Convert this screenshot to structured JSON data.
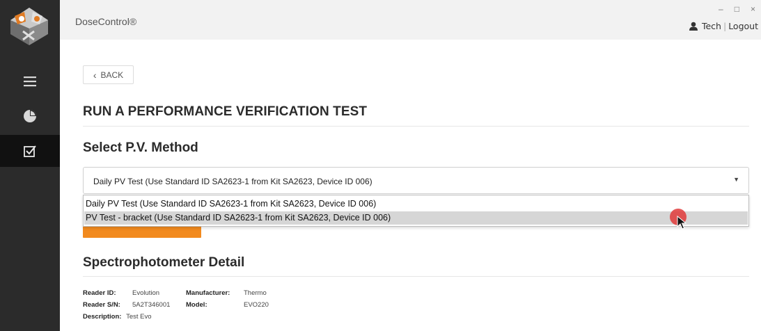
{
  "header": {
    "app_title": "DoseControl®",
    "minimize": "–",
    "maximize": "□",
    "close": "×",
    "user_name": "Tech",
    "separator": "|",
    "logout": "Logout"
  },
  "sidebar": {
    "items": [
      {
        "icon": "menu-icon"
      },
      {
        "icon": "pie-chart-icon"
      },
      {
        "icon": "checkbox-icon",
        "active": true
      }
    ]
  },
  "main": {
    "back_label": "BACK",
    "back_chevron": "‹",
    "page_title": "RUN A PERFORMANCE VERIFICATION TEST",
    "select_section_title": "Select P.V. Method",
    "select_value": "Daily PV Test (Use Standard ID SA2623-1 from Kit SA2623, Device ID 006)",
    "select_arrow": "▼",
    "options": [
      "Daily PV Test (Use Standard ID SA2623-1 from Kit SA2623, Device ID 006)",
      "PV Test - bracket (Use Standard ID SA2623-1 from Kit SA2623, Device ID 006)"
    ],
    "highlighted_option_index": 1,
    "spectro_title": "Spectrophotometer Detail",
    "spectro": {
      "reader_id_label": "Reader ID:",
      "reader_id_value": "Evolution",
      "manufacturer_label": "Manufacturer:",
      "manufacturer_value": "Thermo",
      "reader_sn_label": "Reader S/N:",
      "reader_sn_value": "5A2T346001",
      "model_label": "Model:",
      "model_value": "EVO220",
      "description_label": "Description:",
      "description_value": "Test Evo"
    }
  },
  "colors": {
    "sidebar_bg": "#2b2b2b",
    "sidebar_active_bg": "#111111",
    "header_bg": "#f2f2f2",
    "accent_orange": "#f28a1e",
    "highlight_bg": "#d6d6d6",
    "cursor_red": "#e03a3a"
  }
}
